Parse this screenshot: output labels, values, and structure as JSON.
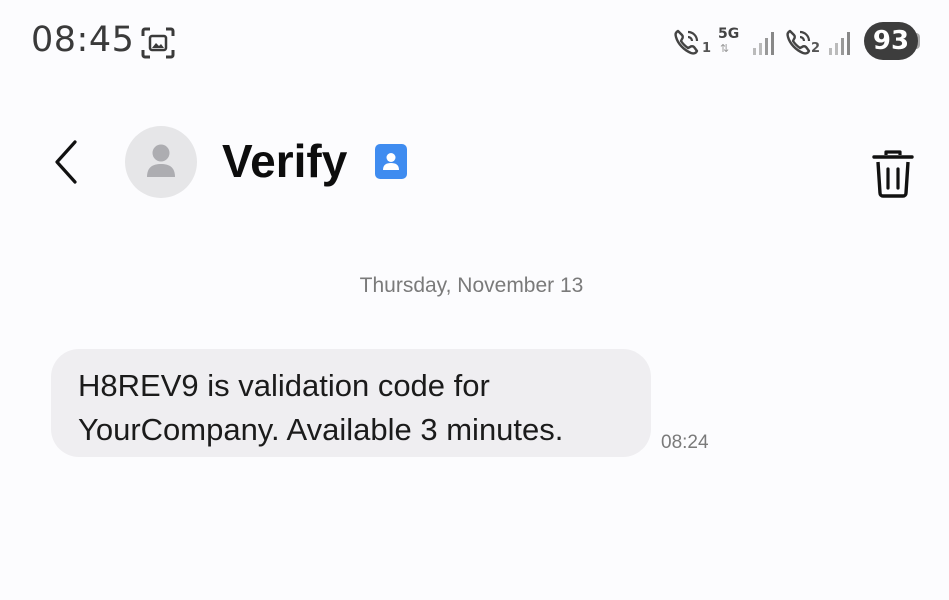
{
  "status_bar": {
    "time": "08:45",
    "sim1_label": "1",
    "network_type": "5G",
    "network_arrows": "⇅",
    "sim2_label": "2",
    "battery_level": "93",
    "icons": [
      "screenshot-icon",
      "call-sim1-icon",
      "signal-sim1-icon",
      "call-sim2-icon",
      "signal-sim2-icon"
    ]
  },
  "header": {
    "contact_name": "Verify",
    "icons": [
      "back-arrow-icon",
      "avatar-person-icon",
      "contact-card-icon",
      "trash-icon"
    ]
  },
  "conversation": {
    "date_divider": "Thursday, November 13",
    "messages": [
      {
        "text": "H8REV9 is validation code for YourCompany. Available 3 minutes.",
        "time": "08:24"
      }
    ]
  },
  "colors": {
    "background": "#fcfcfe",
    "bubble": "#efeef1",
    "badge_blue": "#3f8cf0",
    "battery_pill": "#3d3d3d"
  }
}
